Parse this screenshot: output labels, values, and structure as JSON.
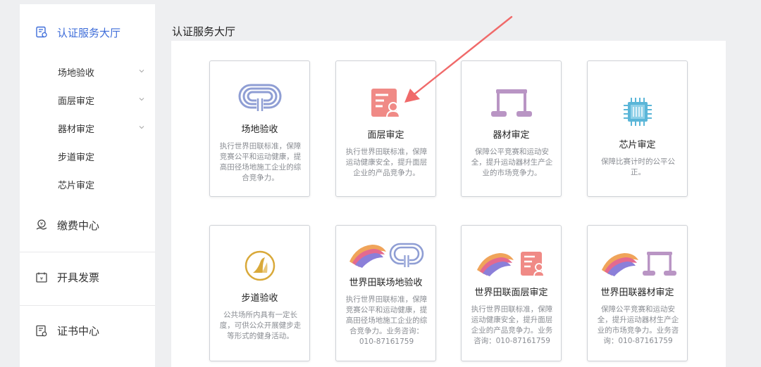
{
  "sidebar": {
    "main": {
      "label": "认证服务大厅",
      "icon": "certificate-hall-icon"
    },
    "sub_items": [
      {
        "label": "场地验收",
        "expandable": true
      },
      {
        "label": "面层审定",
        "expandable": true
      },
      {
        "label": "器材审定",
        "expandable": true
      },
      {
        "label": "步道审定",
        "expandable": false
      },
      {
        "label": "芯片审定",
        "expandable": false
      }
    ],
    "groups": [
      {
        "label": "缴费中心",
        "icon": "payment-icon"
      },
      {
        "label": "开具发票",
        "icon": "invoice-icon"
      },
      {
        "label": "证书中心",
        "icon": "certificate-icon"
      }
    ]
  },
  "main": {
    "title": "认证服务大厅",
    "cards": [
      {
        "title": "场地验收",
        "desc": "执行世界田联标准，保障竞赛公平和运动健康，提高田径场地施工企业的综合竞争力。",
        "icon": "track-icon"
      },
      {
        "title": "面层审定",
        "desc": "执行世界田联标准，保障运动健康安全，提升面层企业的产品竞争力。",
        "icon": "surface-document-icon"
      },
      {
        "title": "器材审定",
        "desc": "保障公平竞赛和运动安全，提升运动器材生产企业的市场竞争力。",
        "icon": "hurdle-icon"
      },
      {
        "title": "芯片审定",
        "desc": "保障比赛计时的公平公正。",
        "icon": "chip-icon"
      },
      {
        "title": "步道验收",
        "desc": "公共场所内具有一定长度，可供公众开展健步走等形式的健身活动。",
        "icon": "trail-icon"
      },
      {
        "title": "世界田联场地验收",
        "desc": "执行世界田联标准，保障竞赛公平和运动健康，提高田径场地施工企业的综合竞争力。业务咨询：010-87161759",
        "icon": "wa-track-icon"
      },
      {
        "title": "世界田联面层审定",
        "desc": "执行世界田联标准，保障运动健康安全，提升面层企业的产品竞争力。业务咨询：010-87161759",
        "icon": "wa-surface-icon"
      },
      {
        "title": "世界田联器材审定",
        "desc": "保障公平竞赛和运动安全，提升运动器材生产企业的市场竞争力。业务咨询：010-87161759",
        "icon": "wa-equipment-icon"
      }
    ]
  },
  "colors": {
    "accent": "#3d6cd9",
    "arrow": "#f06a6a",
    "track": "#8f9ed4",
    "surface": "#f08a86",
    "hurdle": "#b995c4",
    "chip": "#5bb6d8",
    "trail": "#d9a93a"
  }
}
